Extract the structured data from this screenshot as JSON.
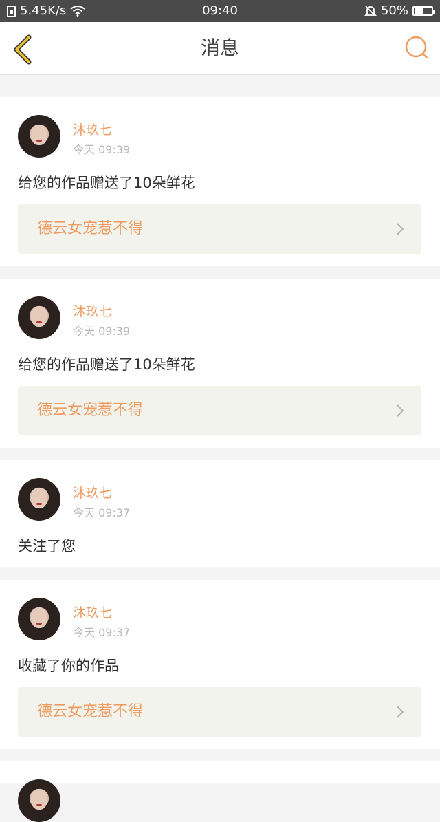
{
  "status_bar": {
    "network_speed": "5.45K/s",
    "time": "09:40",
    "battery": "50%"
  },
  "header": {
    "title": "消息"
  },
  "messages": [
    {
      "user": "沐玖七",
      "time": "今天 09:39",
      "text": "给您的作品赠送了10朵鲜花",
      "work_title": "德云女宠惹不得"
    },
    {
      "user": "沐玖七",
      "time": "今天 09:39",
      "text": "给您的作品赠送了10朵鲜花",
      "work_title": "德云女宠惹不得"
    },
    {
      "user": "沐玖七",
      "time": "今天 09:37",
      "text": "关注了您"
    },
    {
      "user": "沐玖七",
      "time": "今天 09:37",
      "text": "收藏了你的作品",
      "work_title": "德云女宠惹不得"
    }
  ],
  "colors": {
    "accent": "#ef9a5e",
    "back_arrow": "#f2c230",
    "status_bar": "#4a4a4a",
    "work_link_bg": "#f3f3ed"
  },
  "icons": {
    "back": "chevron-left-icon",
    "search": "search-icon",
    "link": "chevron-right-icon"
  }
}
